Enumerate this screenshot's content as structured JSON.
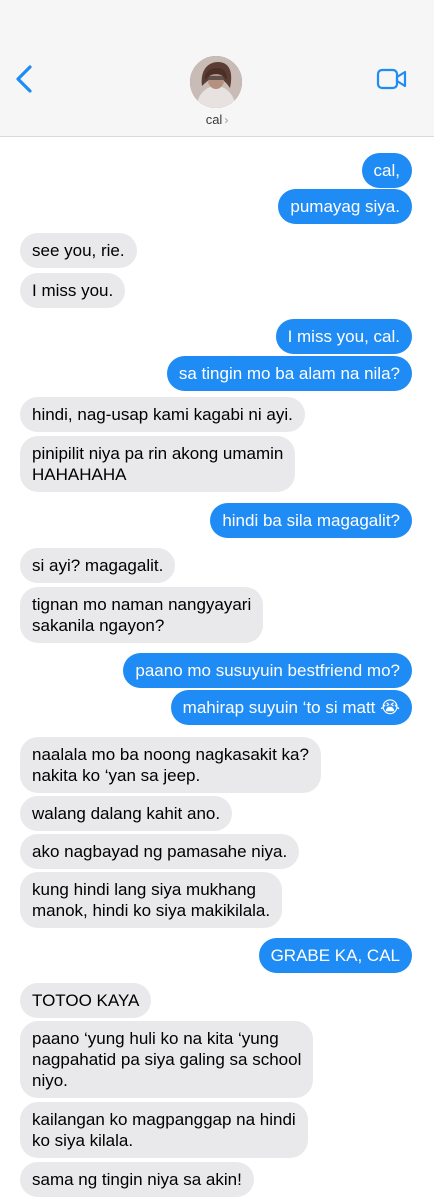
{
  "header": {
    "contact_name": "cal",
    "back_icon": "chevron-left-icon",
    "video_icon": "video-camera-icon",
    "accent_color": "#1f8bf4"
  },
  "messages": [
    {
      "side": "out",
      "text": "cal,"
    },
    {
      "side": "out",
      "text": "pumayag siya."
    },
    {
      "side": "in",
      "text": "see you, rie."
    },
    {
      "side": "in",
      "text": "I miss you."
    },
    {
      "side": "out",
      "text": "I miss you, cal."
    },
    {
      "side": "out",
      "text": "sa tingin mo ba alam na nila?"
    },
    {
      "side": "in",
      "text": "hindi, nag-usap kami kagabi ni ayi."
    },
    {
      "side": "in",
      "text": "pinipilit niya pa rin akong umamin\nHAHAHAHA"
    },
    {
      "side": "out",
      "text": "hindi ba sila magagalit?"
    },
    {
      "side": "in",
      "text": "si ayi? magagalit."
    },
    {
      "side": "in",
      "text": "tignan mo naman nangyayari\nsakanila ngayon?"
    },
    {
      "side": "out",
      "text": "paano mo susuyuin bestfriend mo?"
    },
    {
      "side": "out",
      "text": "mahirap suyuin ‘to si matt 😭"
    },
    {
      "side": "in",
      "text": "naalala mo ba noong nagkasakit ka?\nnakita ko ‘yan sa jeep."
    },
    {
      "side": "in",
      "text": "walang dalang kahit ano."
    },
    {
      "side": "in",
      "text": "ako nagbayad ng pamasahe niya."
    },
    {
      "side": "in",
      "text": "kung hindi lang siya mukhang\nmanok, hindi ko siya makikilala."
    },
    {
      "side": "out",
      "text": "GRABE KA, CAL"
    },
    {
      "side": "in",
      "text": "TOTOO KAYA"
    },
    {
      "side": "in",
      "text": "paano ‘yung huli ko na kita ‘yung\nnagpahatid pa siya galing sa school\nniyo."
    },
    {
      "side": "in",
      "text": "kailangan ko magpanggap na hindi\nko siya kilala."
    },
    {
      "side": "in",
      "text": "sama ng tingin niya sa akin!"
    }
  ]
}
